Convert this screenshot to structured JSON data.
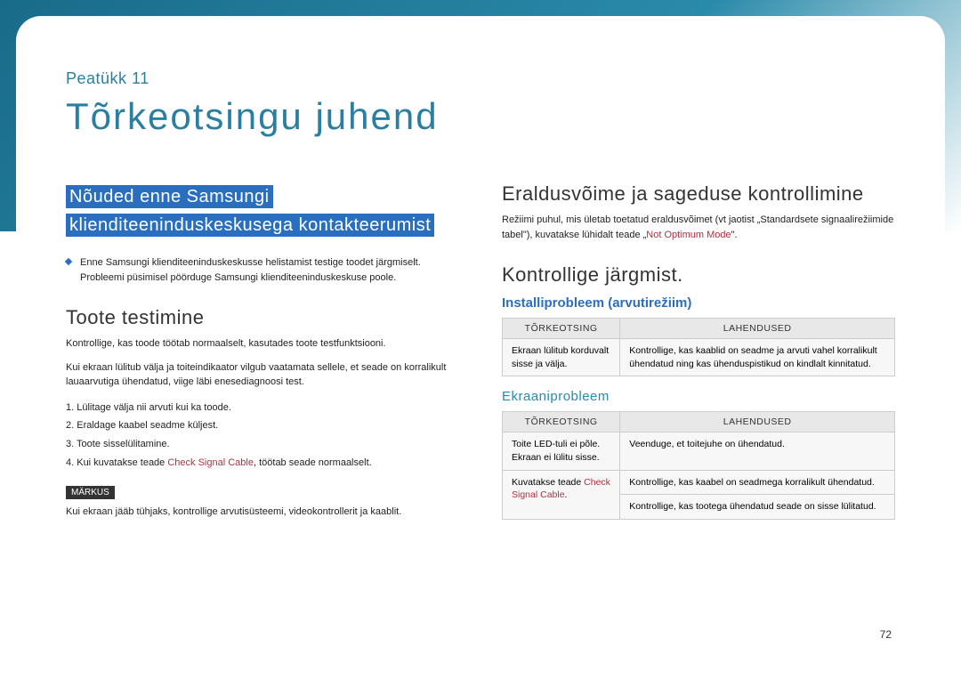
{
  "chapter": "Peatükk 11",
  "title": "Tõrkeotsingu juhend",
  "page_number": "72",
  "left": {
    "highlight_line1": "Nõuded enne Samsungi",
    "highlight_line2": "klienditeeninduskeskusega kontakteerumist",
    "bullet": "Enne Samsungi klienditeeninduskeskusse helistamist testige toodet järgmiselt. Probleemi püsimisel pöörduge Samsungi klienditeeninduskeskuse poole.",
    "section1": "Toote testimine",
    "p1": "Kontrollige, kas toode töötab normaalselt, kasutades toote testfunktsiooni.",
    "p2": "Kui ekraan lülitub välja ja toiteindikaator vilgub vaatamata sellele, et seade on korralikult lauaarvutiga ühendatud, viige läbi enesediagnoosi test.",
    "steps": [
      "1.  Lülitage välja nii arvuti kui ka toode.",
      "2.  Eraldage kaabel seadme küljest.",
      "3.  Toote sisselülitamine.",
      "4.  Kui kuvatakse teade "
    ],
    "step4_red": "Check Signal Cable",
    "step4_tail": ", töötab seade normaalselt.",
    "note_label": "MÄRKUS",
    "note_text": "Kui ekraan jääb tühjaks, kontrollige arvutisüsteemi, videokontrollerit ja kaablit."
  },
  "right": {
    "section1": "Eraldusvõime ja sageduse kontrollimine",
    "p1a": "Režiimi puhul, mis ületab toetatud eraldusvõimet (vt jaotist „Standardsete signaalirežiimide tabel\"), kuvatakse lühidalt teade „",
    "p1_red": "Not Optimum Mode",
    "p1b": "\".",
    "section2": "Kontrollige järgmist.",
    "sub_blue": "Installiprobleem (arvutirežiim)",
    "table1": {
      "th1": "TÕRKEOTSING",
      "th2": "LAHENDUSED",
      "rows": [
        {
          "c1": "Ekraan lülitub korduvalt sisse ja välja.",
          "c2": "Kontrollige, kas kaablid on seadme ja arvuti vahel korralikult ühendatud ning kas ühenduspistikud on kindlalt kinnitatud."
        }
      ]
    },
    "sub_teal": "Ekraaniprobleem",
    "table2": {
      "th1": "TÕRKEOTSING",
      "th2": "LAHENDUSED",
      "rows": [
        {
          "c1": "Toite LED-tuli ei põle. Ekraan ei lülitu sisse.",
          "c2": "Veenduge, et toitejuhe on ühendatud."
        },
        {
          "c1a": "Kuvatakse teade ",
          "c1_red": "Check Signal Cable",
          "c1b": ".",
          "c2a": "Kontrollige, kas kaabel on seadmega korralikult ühendatud.",
          "c2b": "Kontrollige, kas tootega ühendatud seade on sisse lülitatud."
        }
      ]
    }
  }
}
